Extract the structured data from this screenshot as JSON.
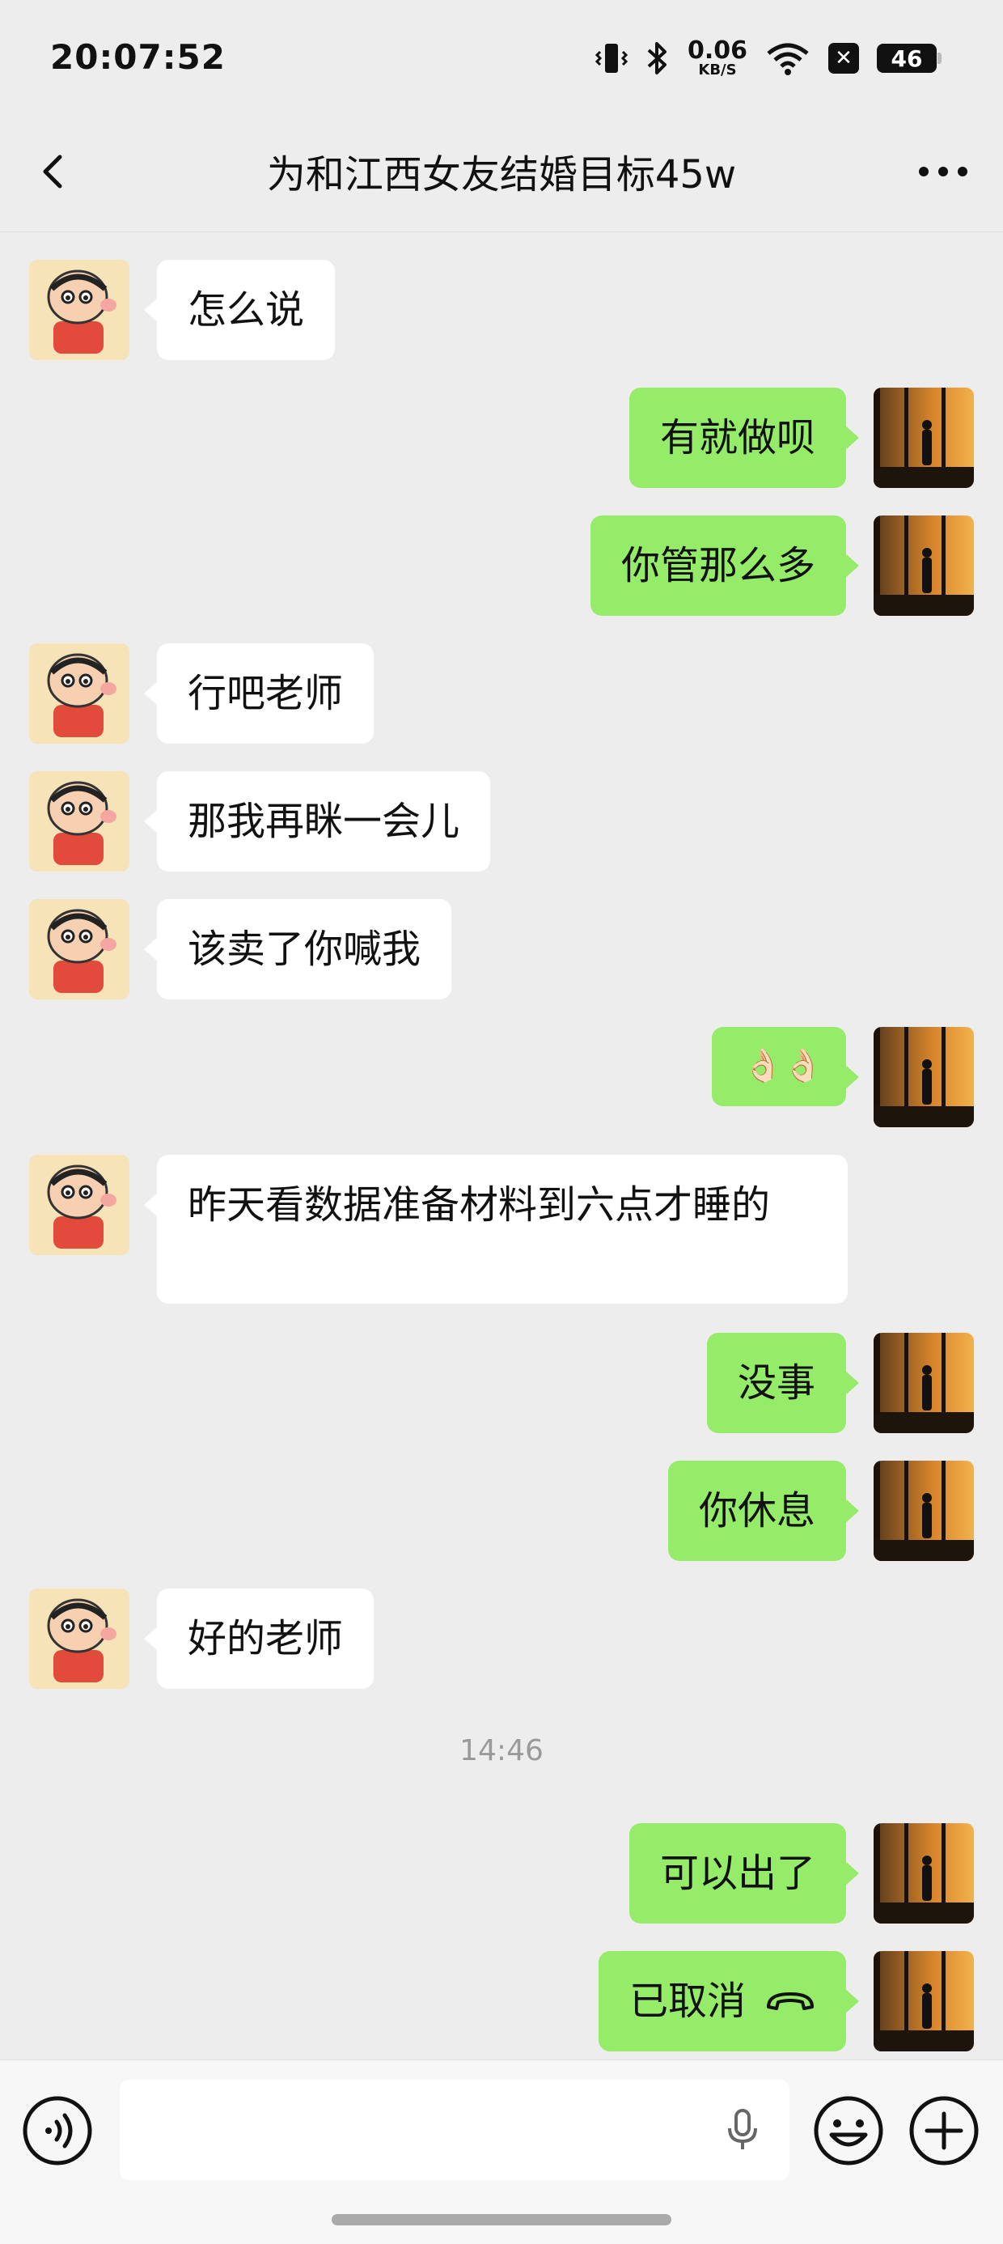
{
  "status_bar": {
    "time": "20:07:52",
    "net_speed": "0.06",
    "net_unit": "KB/S",
    "battery": "46",
    "x_badge": "✕"
  },
  "header": {
    "title": "为和江西女友结婚目标45w",
    "back_icon": "chevron-left-icon",
    "more_icon": "more-icon"
  },
  "messages": [
    {
      "side": "in",
      "text": "怎么说"
    },
    {
      "side": "out",
      "text": "有就做呗"
    },
    {
      "side": "out",
      "text": "你管那么多"
    },
    {
      "side": "in",
      "text": "行吧老师"
    },
    {
      "side": "in",
      "text": "那我再眯一会儿"
    },
    {
      "side": "in",
      "text": "该卖了你喊我"
    },
    {
      "side": "out",
      "text": "👌🏻👌🏻"
    },
    {
      "side": "in",
      "text": "昨天看数据准备材料到六点才睡的"
    },
    {
      "side": "out",
      "text": "没事"
    },
    {
      "side": "out",
      "text": "你休息"
    },
    {
      "side": "in",
      "text": "好的老师"
    },
    {
      "side": "out",
      "text": "可以出了"
    },
    {
      "side": "out",
      "text": "已取消",
      "icon": "hangup-icon"
    }
  ],
  "timestamp": "14:46",
  "input_bar": {
    "voice_icon": "voice-icon",
    "mic_icon": "mic-icon",
    "emoji_icon": "emoji-icon",
    "add_icon": "add-icon"
  },
  "colors": {
    "background": "#ededed",
    "out_bubble": "#95ec69",
    "in_bubble": "#ffffff"
  }
}
